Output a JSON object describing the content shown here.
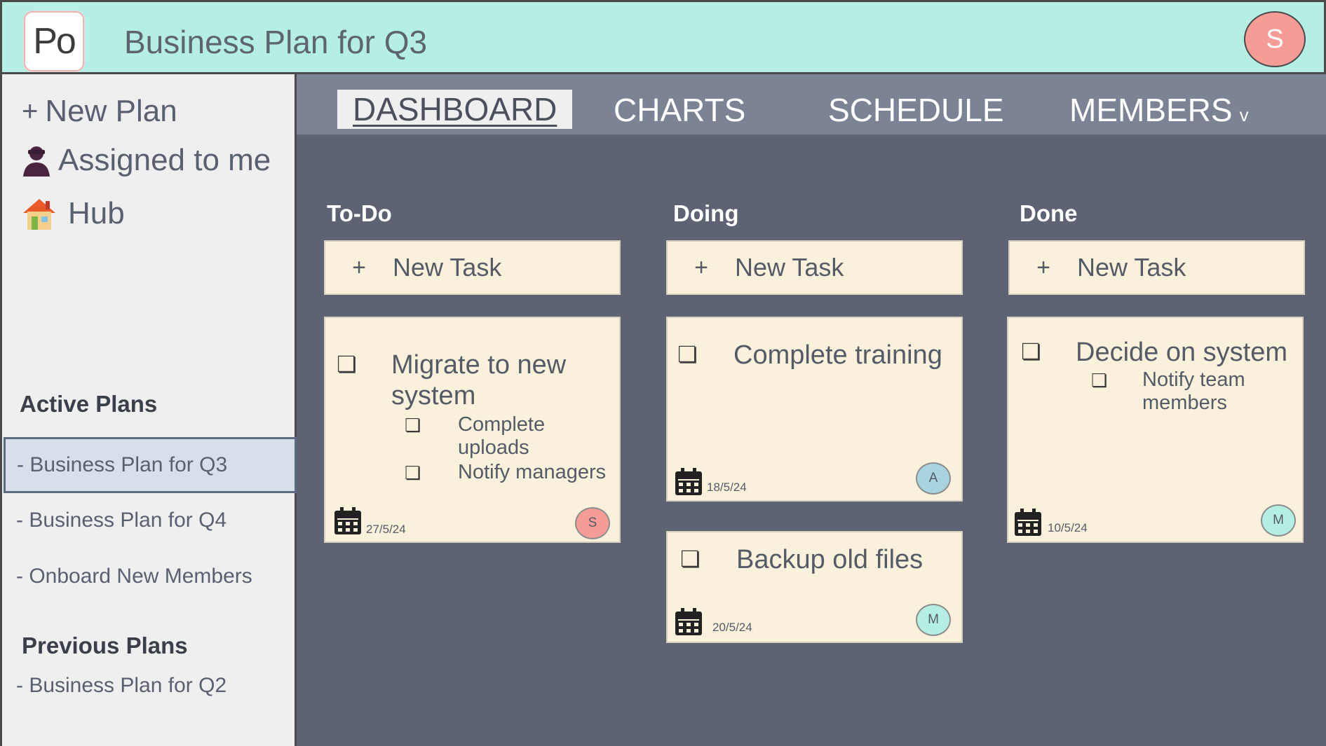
{
  "header": {
    "logo_text": "Po",
    "title": "Business Plan for Q3",
    "user_initial": "S"
  },
  "sidebar": {
    "actions": [
      {
        "label": "New Plan",
        "icon": "plus-icon"
      },
      {
        "label": "Assigned to me",
        "icon": "person-icon"
      },
      {
        "label": "Hub",
        "icon": "house-icon"
      }
    ],
    "active_heading": "Active Plans",
    "active_plans": [
      "- Business Plan for Q3",
      "- Business Plan for Q4",
      "- Onboard New Members"
    ],
    "previous_heading": "Previous Plans",
    "previous_plans": [
      "- Business Plan for Q2"
    ]
  },
  "tabs": [
    {
      "label": "DASHBOARD",
      "active": true
    },
    {
      "label": "CHARTS"
    },
    {
      "label": "SCHEDULE"
    },
    {
      "label": "MEMBERS",
      "caret": "v"
    }
  ],
  "columns": [
    {
      "title": "To-Do",
      "new_task_label": "New Task",
      "cards": [
        {
          "title": "Migrate to new system",
          "subtasks": [
            "Complete uploads",
            "Notify managers"
          ],
          "date": "27/5/24",
          "assignee": "S",
          "assignee_color": "#f59c96"
        }
      ]
    },
    {
      "title": "Doing",
      "new_task_label": "New Task",
      "cards": [
        {
          "title": "Complete training",
          "subtasks": [],
          "date": "18/5/24",
          "assignee": "A",
          "assignee_color": "#a8d4df"
        },
        {
          "title": "Backup old files",
          "subtasks": [],
          "date": "20/5/24",
          "assignee": "M",
          "assignee_color": "#b5efe3"
        }
      ]
    },
    {
      "title": "Done",
      "new_task_label": "New Task",
      "cards": [
        {
          "title": "Decide on system",
          "subtasks": [
            "Notify team members"
          ],
          "date": "10/5/24",
          "assignee": "M",
          "assignee_color": "#b5efe3"
        }
      ]
    }
  ],
  "colors": {
    "header_bg": "#b5efe3",
    "tab_bar": "#7b8394",
    "board_bg": "#5d6373",
    "card_bg": "#f9f1dc",
    "sidebar_bg": "#efefef"
  }
}
